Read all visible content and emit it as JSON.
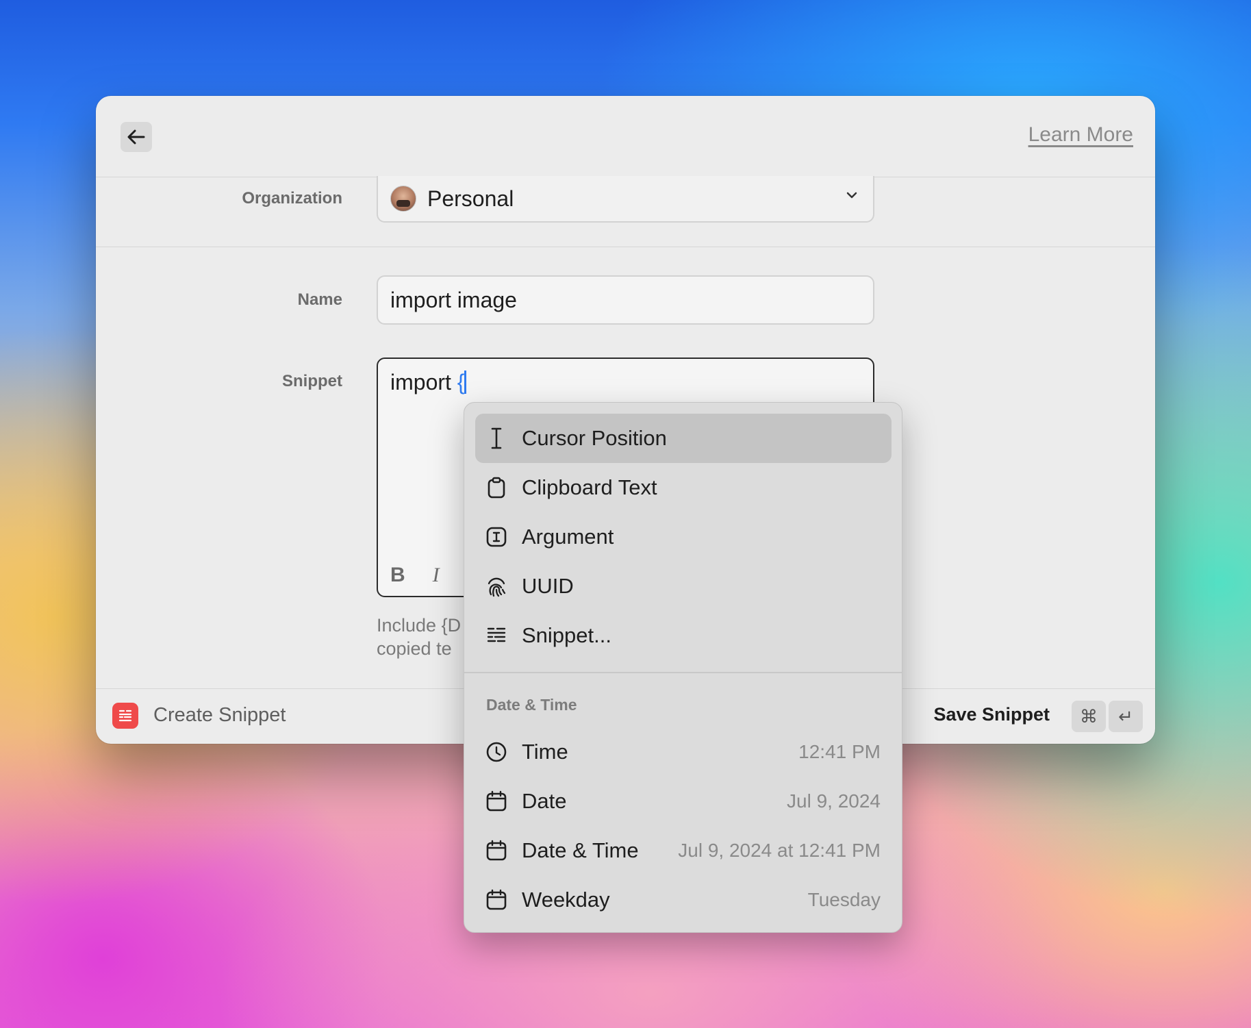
{
  "header": {
    "learn_more": "Learn More"
  },
  "form": {
    "organization_label": "Organization",
    "organization_value": "Personal",
    "name_label": "Name",
    "name_value": "import image",
    "snippet_label": "Snippet",
    "snippet_text": "import ",
    "snippet_brace": "{",
    "toolbar": {
      "bold": "B",
      "italic": "I"
    },
    "help_line1": "Include {D",
    "help_line2": "copied te"
  },
  "footer": {
    "title": "Create Snippet",
    "save_label": "Save Snippet",
    "shortcut_cmd": "⌘",
    "shortcut_enter": "↵"
  },
  "menu": {
    "items": [
      {
        "label": "Cursor Position",
        "icon": "text-cursor-icon",
        "selected": true
      },
      {
        "label": "Clipboard Text",
        "icon": "clipboard-icon"
      },
      {
        "label": "Argument",
        "icon": "argument-icon"
      },
      {
        "label": "UUID",
        "icon": "fingerprint-icon"
      },
      {
        "label": "Snippet...",
        "icon": "snippet-icon"
      }
    ],
    "section_title": "Date & Time",
    "date_items": [
      {
        "label": "Time",
        "value": "12:41 PM",
        "icon": "clock-icon"
      },
      {
        "label": "Date",
        "value": "Jul 9, 2024",
        "icon": "calendar-icon"
      },
      {
        "label": "Date & Time",
        "value": "Jul 9, 2024 at 12:41 PM",
        "icon": "calendar-icon"
      },
      {
        "label": "Weekday",
        "value": "Tuesday",
        "icon": "calendar-icon"
      }
    ]
  },
  "colors": {
    "accent": "#2f7bf0",
    "app_icon": "#ef4a4a"
  }
}
